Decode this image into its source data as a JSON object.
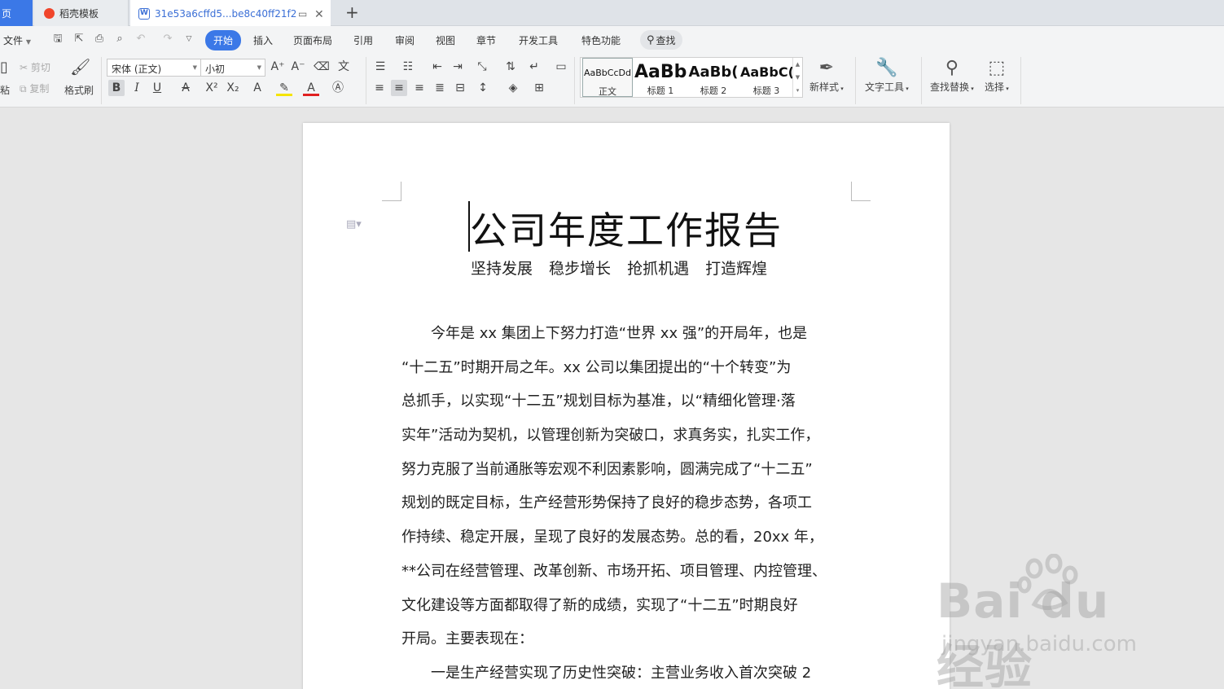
{
  "tabs": {
    "home": "页",
    "template": "稻壳模板",
    "document": "31e53a6cffd5...be8c40ff21f2"
  },
  "menu": {
    "file": "文件",
    "items": [
      "开始",
      "插入",
      "页面布局",
      "引用",
      "审阅",
      "视图",
      "章节",
      "开发工具",
      "特色功能"
    ],
    "search": "查找"
  },
  "ribbon": {
    "paste": "粘",
    "cut": "剪切",
    "copy": "复制",
    "format_painter": "格式刷",
    "font_name": "宋体 (正文)",
    "font_size": "小初",
    "styles": [
      {
        "sample": "AaBbCcDd",
        "label": "正文"
      },
      {
        "sample": "AaBb",
        "label": "标题 1"
      },
      {
        "sample": "AaBb(",
        "label": "标题 2"
      },
      {
        "sample": "AaBbC(",
        "label": "标题 3"
      }
    ],
    "new_style": "新样式",
    "text_tools": "文字工具",
    "find_replace": "查找替换",
    "select": "选择"
  },
  "document": {
    "title": "公司年度工作报告",
    "subtitle": "坚持发展  稳步增长  抢抓机遇  打造辉煌",
    "lines": [
      "　　今年是 xx 集团上下努力打造“世界 xx 强”的开局年，也是",
      "“十二五”时期开局之年。xx 公司以集团提出的“十个转变”为",
      "总抓手，以实现“十二五”规划目标为基准，以“精细化管理·落",
      "实年”活动为契机，以管理创新为突破口，求真务实，扎实工作，",
      "努力克服了当前通胀等宏观不利因素影响，圆满完成了“十二五”",
      "规划的既定目标，生产经营形势保持了良好的稳步态势，各项工",
      "作持续、稳定开展，呈现了良好的发展态势。总的看，20xx 年，",
      "**公司在经营管理、改革创新、市场开拓、项目管理、内控管理、",
      "文化建设等方面都取得了新的成绩，实现了“十二五”时期良好",
      "开局。主要表现在：",
      "　　一是生产经营实现了历史性突破：主营业务收入首次突破 2"
    ]
  },
  "watermark": {
    "main": "Bai du 经验",
    "sub": "jingyan.baidu.com"
  }
}
